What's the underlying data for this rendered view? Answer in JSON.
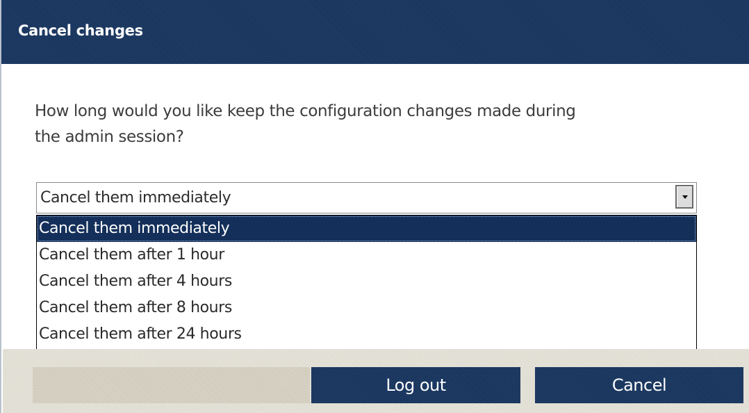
{
  "dialog": {
    "title": "Cancel changes",
    "question_line1": "How long would you like keep the configuration changes made during",
    "question_line2": "the admin session?"
  },
  "select": {
    "value": "Cancel them immediately",
    "arrow_icon": "dropdown-arrow-icon",
    "options": [
      {
        "label": "Cancel them immediately",
        "selected": true
      },
      {
        "label": "Cancel them after 1 hour",
        "selected": false
      },
      {
        "label": "Cancel them after 4 hours",
        "selected": false
      },
      {
        "label": "Cancel them after 8 hours",
        "selected": false
      },
      {
        "label": "Cancel them after 24 hours",
        "selected": false
      }
    ]
  },
  "buttons": {
    "logout_label": "Log out",
    "cancel_label": "Cancel"
  },
  "colors": {
    "header": "#18355e",
    "selected_option": "#14305a",
    "footer": "#e5e2d8"
  }
}
